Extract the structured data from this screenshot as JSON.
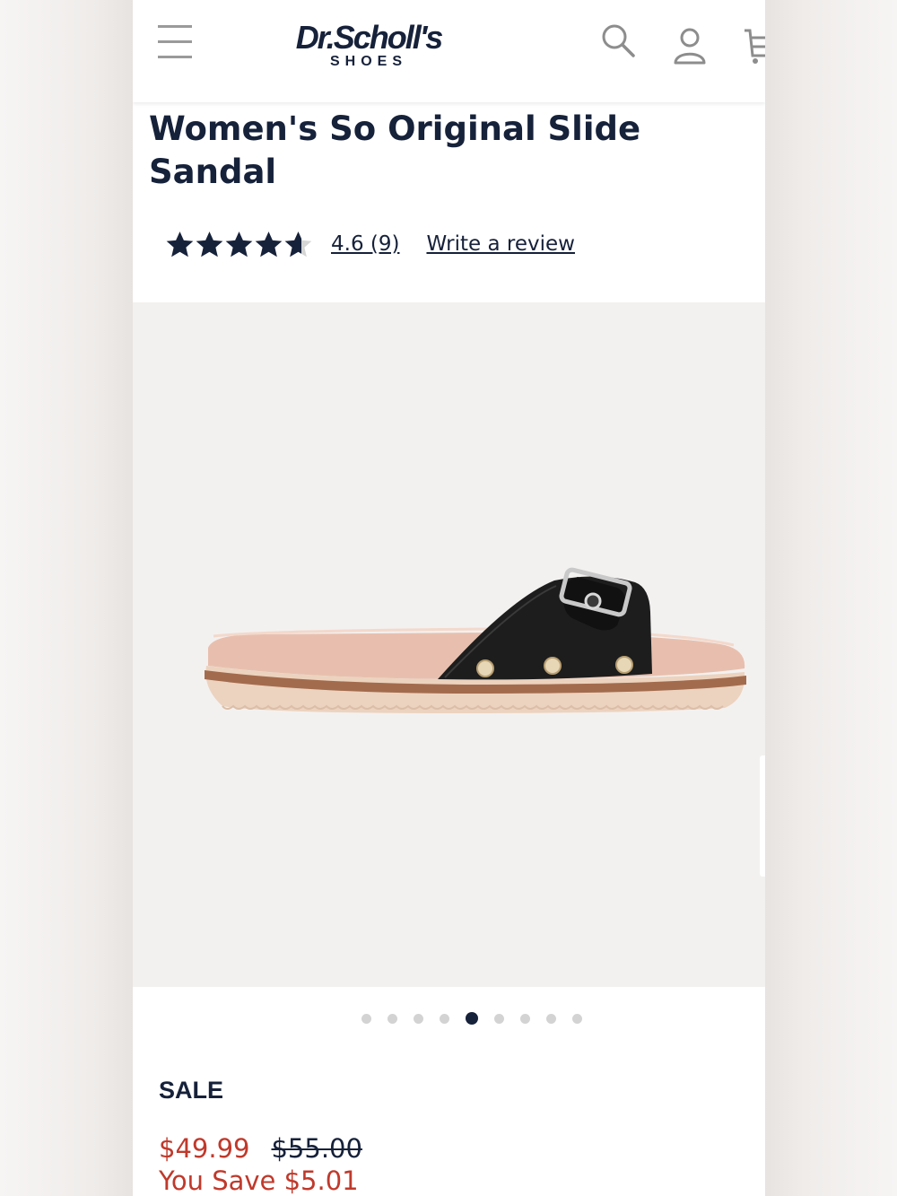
{
  "header": {
    "logo_main": "Dr.Scholl's",
    "logo_sub": "SHOES",
    "icons": [
      "menu-icon",
      "search-icon",
      "account-icon",
      "cart-icon"
    ]
  },
  "product": {
    "title": "Women's So Original Slide Sandal",
    "rating": 4.6,
    "rating_text": "4.6 (9)",
    "write_review": "Write a review",
    "image_count": 9,
    "active_image": 5
  },
  "pricing": {
    "sale_label": "SALE",
    "price_now": "$49.99",
    "price_was": "$55.00",
    "you_save": "You Save $5.01"
  },
  "colors": {
    "navy": "#16213a",
    "sale_red": "#c0392b",
    "gallery_bg": "#f3f1f0"
  }
}
